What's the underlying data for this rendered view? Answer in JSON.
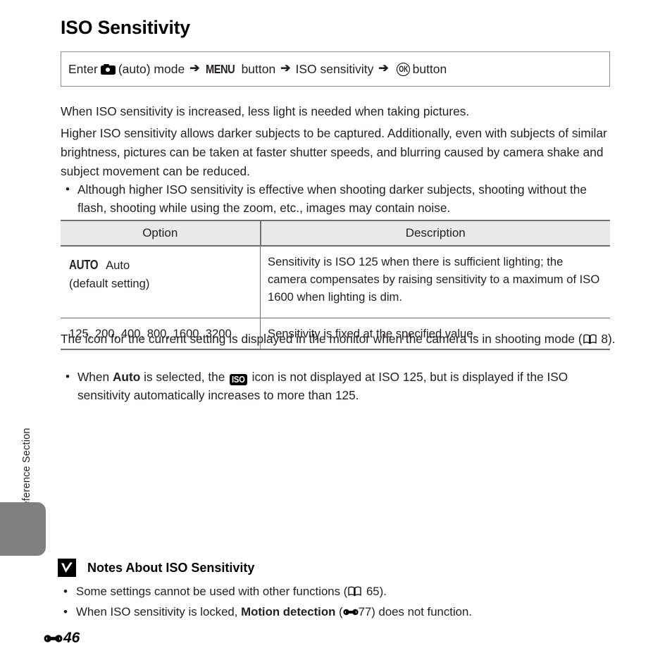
{
  "side_tab": {
    "label": "Reference Section"
  },
  "page": {
    "title": "ISO Sensitivity",
    "folio_number": "46",
    "folio_marker_icon": "e-reference-icon"
  },
  "nav_path": {
    "prefix": "Enter",
    "camera_icon": "camera-icon",
    "mode_text": "(auto) mode",
    "arrow": "➔",
    "menu_icon_label": "MENU",
    "menu_suffix": "button",
    "menu_item": "ISO sensitivity",
    "ok_icon_label": "OK",
    "ok_suffix": "button"
  },
  "intro": {
    "paragraph_1": "When ISO sensitivity is increased, less light is needed when taking pictures.",
    "paragraph_2": "Higher ISO sensitivity allows darker subjects to be captured. Additionally, even with subjects of similar brightness, pictures can be taken at faster shutter speeds, and blurring caused by camera shake and subject movement can be reduced.",
    "bullet_1": "Although higher ISO sensitivity is effective when shooting darker subjects, shooting without the flash, shooting while using the zoom, etc., images may contain noise."
  },
  "table": {
    "headers": {
      "option": "Option",
      "description": "Description"
    },
    "rows": [
      {
        "option_icon_label": "AUTO",
        "option_name": "Auto",
        "option_note": "(default setting)",
        "description": "Sensitivity is ISO 125 when there is sufficient lighting; the camera compensates by raising sensitivity to a maximum of ISO 1600 when lighting is dim."
      },
      {
        "option_values": "125, 200, 400, 800, 1600, 3200",
        "description": "Sensitivity is fixed at the specified value."
      }
    ]
  },
  "after_table": {
    "paragraph_lead": "The icon for the current setting is displayed in the monitor when the camera is in shooting mode (",
    "book_icon": "book-icon",
    "page_ref": "8",
    "paragraph_tail": ").",
    "bullet_lead": "When ",
    "bullet_bold": "Auto",
    "bullet_mid": " is selected, the ",
    "iso_icon_label": "ISO",
    "bullet_tail": " icon is not displayed at ISO 125, but is displayed if the ISO sensitivity automatically increases to more than 125."
  },
  "notes": {
    "warning_icon": "warning-check-icon",
    "title": "Notes About ISO Sensitivity",
    "items": [
      {
        "lead": "Some settings cannot be used with other functions (",
        "ref_icon": "book-icon",
        "ref": "65",
        "tail": ")."
      },
      {
        "lead": "When ISO sensitivity is locked, ",
        "bold": "Motion detection",
        "mid": " (",
        "ref_icon": "e-reference-icon",
        "ref": "77",
        "tail": ") does not function."
      }
    ]
  },
  "colors": {
    "text": "#231f20",
    "table_header_bg": "#e9e9e9",
    "rule": "#6f6f6f",
    "box_border": "#8e8e8e",
    "side_tab": "#808080"
  }
}
